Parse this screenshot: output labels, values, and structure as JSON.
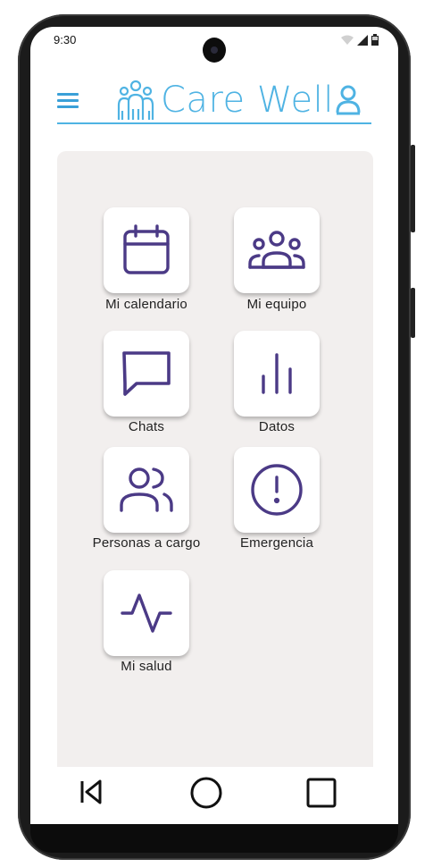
{
  "status": {
    "time": "9:30"
  },
  "header": {
    "app_name": "Care Well"
  },
  "tiles": [
    {
      "label": "Mi calendario",
      "icon": "calendar-icon"
    },
    {
      "label": "Mi equipo",
      "icon": "team-icon"
    },
    {
      "label": "Chats",
      "icon": "chat-icon"
    },
    {
      "label": "Datos",
      "icon": "bar-chart-icon"
    },
    {
      "label": "Personas a cargo",
      "icon": "people-icon"
    },
    {
      "label": "Emergencia",
      "icon": "alert-icon"
    },
    {
      "label": "Mi salud",
      "icon": "pulse-icon"
    }
  ],
  "colors": {
    "accent": "#4fb3e3",
    "icon": "#4b3a86",
    "panel": "#f2efee"
  }
}
